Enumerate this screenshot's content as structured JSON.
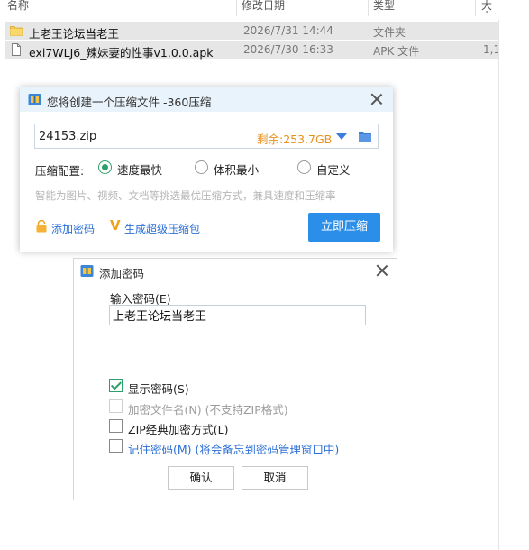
{
  "explorer": {
    "columns": {
      "name": "名称",
      "date": "修改日期",
      "type": "类型",
      "size": "大小"
    },
    "rows": [
      {
        "name": "上老王论坛当老王",
        "date": "2026/7/31 14:44",
        "type": "文件夹",
        "size": "",
        "icon": "folder-icon"
      },
      {
        "name": "exi7WLJ6_辣妹妻的性事v1.0.0.apk",
        "date": "2026/7/30 16:33",
        "type": "APK 文件",
        "size": "1,1",
        "icon": "file-icon"
      }
    ]
  },
  "compress_dialog": {
    "title": "您将创建一个压缩文件 -360压缩",
    "filename": "24153.zip",
    "remaining": "剩余:253.7GB",
    "config_label": "压缩配置:",
    "options": [
      {
        "label": "速度最快",
        "selected": true
      },
      {
        "label": "体积最小",
        "selected": false
      },
      {
        "label": "自定义",
        "selected": false
      }
    ],
    "hint": "智能为图片、视频、文档等挑选最优压缩方式，兼具速度和压缩率",
    "add_password_link": "添加密码",
    "super_link": "生成超级压缩包",
    "compress_button": "立即压缩",
    "accent_color": "#2b8ee8"
  },
  "password_dialog": {
    "title": "添加密码",
    "input_label": "输入密码(E)",
    "password_value": "上老王论坛当老王",
    "checkboxes": [
      {
        "label": "显示密码(S)",
        "note": "",
        "checked": true,
        "disabled": false
      },
      {
        "label": "加密文件名(N)",
        "note": "(不支持ZIP格式)",
        "checked": false,
        "disabled": true
      },
      {
        "label": "ZIP经典加密方式(L)",
        "note": "",
        "checked": false,
        "disabled": false
      },
      {
        "label": "记住密码(M)",
        "note": "(将会备忘到密码管理窗口中)",
        "checked": false,
        "disabled": false
      }
    ],
    "ok_button": "确认",
    "cancel_button": "取消"
  }
}
